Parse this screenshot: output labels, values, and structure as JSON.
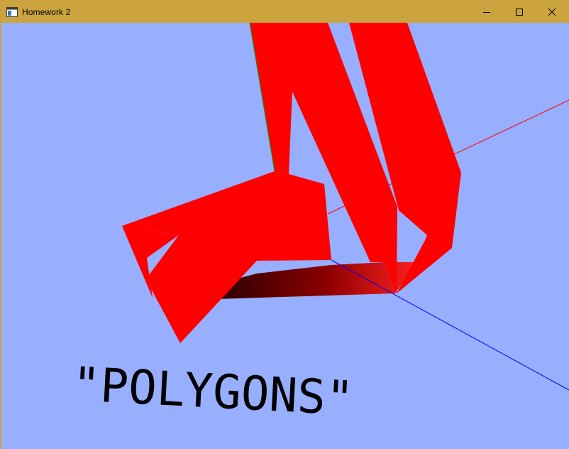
{
  "window": {
    "title": "Homework 2",
    "icon": "window-app-icon",
    "controls": [
      "minimize-icon",
      "maximize-icon",
      "close-icon"
    ]
  },
  "canvas": {
    "background": "#98aefe",
    "polygon_color": "#ff0000",
    "shadow_color": "#6a0000",
    "axis_colors": {
      "x": "#ff0000",
      "y": "#00a000",
      "z": "#0000ff"
    },
    "caption": "\"POLYGONS\"",
    "caption_color": "#000000"
  }
}
